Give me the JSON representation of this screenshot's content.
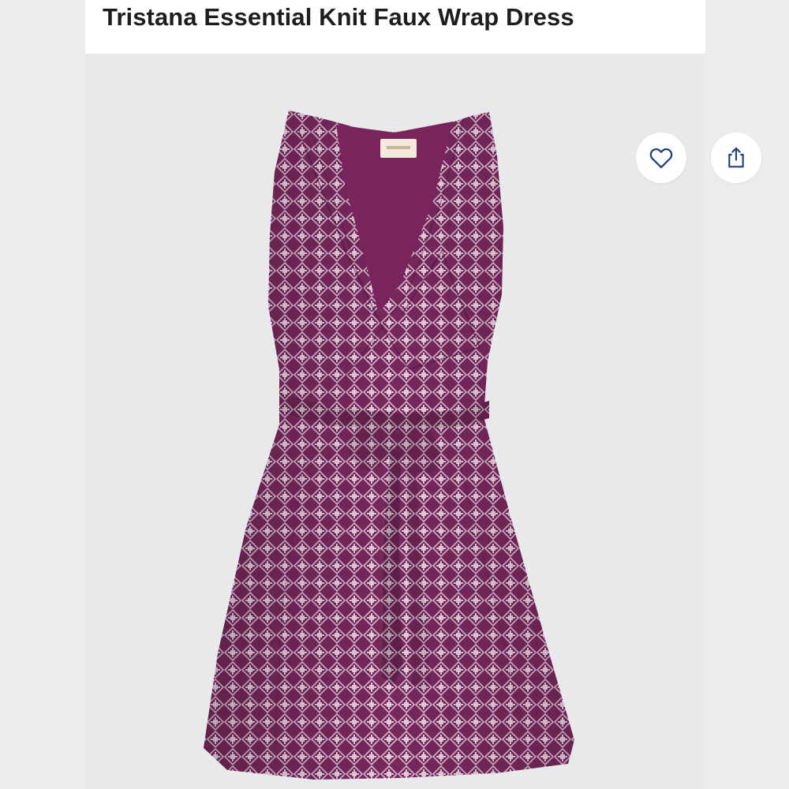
{
  "product": {
    "title": "Tristana Essential Knit Faux Wrap Dress"
  },
  "actions": {
    "favorite_icon": "heart-outline-icon",
    "share_icon": "share-upload-icon"
  },
  "image": {
    "description_colors": {
      "dress_base": "#7a2a5e",
      "dress_pattern": "#d9b7cf",
      "lining": "#8c2a6a",
      "label": "#f3e9dc",
      "background": "#e9e9ec",
      "icon_blue": "#1f3f7a"
    }
  }
}
